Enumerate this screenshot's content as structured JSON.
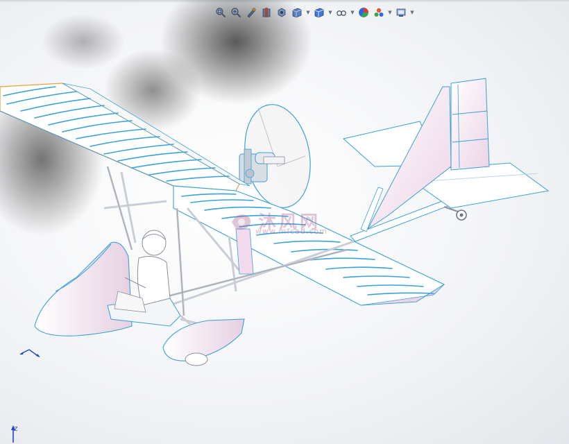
{
  "toolbar": {
    "items": [
      {
        "icon": "zoom-to-fit-icon"
      },
      {
        "icon": "zoom-to-area-icon"
      },
      {
        "icon": "previous-view-icon"
      },
      {
        "icon": "section-view-icon"
      },
      {
        "icon": "dynamic-annotation-icon"
      },
      {
        "icon": "view-orientation-icon",
        "dropdown": true
      },
      {
        "icon": "display-style-icon",
        "dropdown": true
      },
      {
        "icon": "hide-show-items-icon",
        "dropdown": true
      },
      {
        "icon": "edit-appearance-icon"
      },
      {
        "icon": "apply-scene-icon",
        "dropdown": true
      },
      {
        "icon": "view-settings-icon",
        "dropdown": true
      }
    ]
  },
  "watermark": {
    "text": "沐风网",
    "url": "www.mfcad.com"
  },
  "triad": {
    "z_label": "Z"
  },
  "colors": {
    "edge_blue": "#3aa0d8",
    "edge_orange": "#e8a040",
    "surface_white": "#ffffff",
    "surface_pink": "#f2d9ec"
  }
}
